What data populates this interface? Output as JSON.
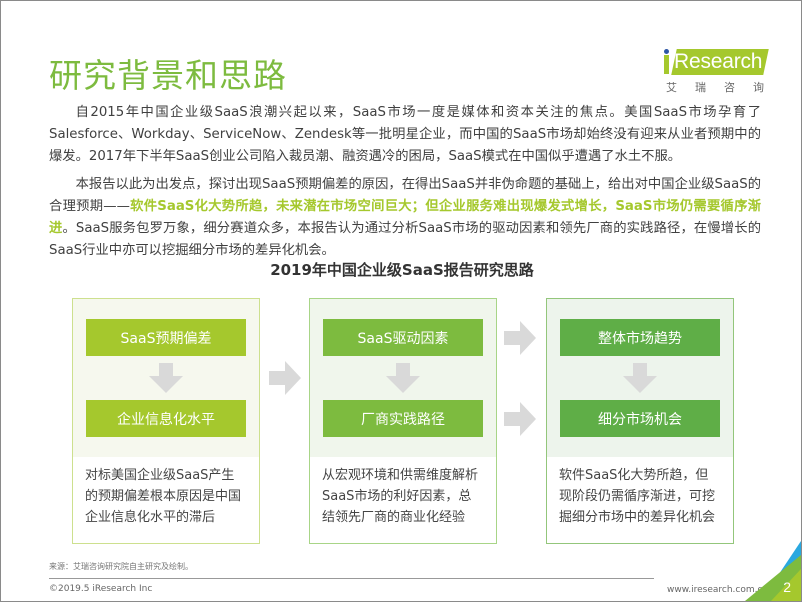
{
  "page": {
    "title": "研究背景和思路",
    "number": "2"
  },
  "logo": {
    "brand": "iResearch",
    "brand_rest": "Research",
    "subtitle": "艾瑞咨询"
  },
  "body": {
    "paragraph1": "自2015年中国企业级SaaS浪潮兴起以来，SaaS市场一度是媒体和资本关注的焦点。美国SaaS市场孕育了Salesforce、Workday、ServiceNow、Zendesk等一批明星企业，而中国的SaaS市场却始终没有迎来从业者预期中的爆发。2017年下半年SaaS创业公司陷入裁员潮、融资遇冷的困局，SaaS模式在中国似乎遭遇了水土不服。",
    "paragraph2_before": "本报告以此为出发点，探讨出现SaaS预期偏差的原因，在得出SaaS并非伪命题的基础上，给出对中国企业级SaaS的合理预期——",
    "paragraph2_highlight": "软件SaaS化大势所趋，未来潜在市场空间巨大；但企业服务难出现爆发式增长，SaaS市场仍需要循序渐进",
    "paragraph2_after": "。SaaS服务包罗万象，细分赛道众多，本报告认为通过分析SaaS市场的驱动因素和领先厂商的实践路径，在慢增长的SaaS行业中亦可以挖掘细分市场的差异化机会。"
  },
  "diagram": {
    "title": "2019年中国企业级SaaS报告研究思路",
    "panels": [
      {
        "top_box": "SaaS预期偏差",
        "bottom_box": "企业信息化水平",
        "description": "对标美国企业级SaaS产生的预期偏差根本原因是中国企业信息化水平的滞后",
        "color": "#a5c82d"
      },
      {
        "top_box": "SaaS驱动因素",
        "bottom_box": "厂商实践路径",
        "description": "从宏观环境和供需维度解析SaaS市场的利好因素，总结领先厂商的商业化经验",
        "color": "#7dbb3f"
      },
      {
        "top_box": "整体市场趋势",
        "bottom_box": "细分市场机会",
        "description": "软件SaaS化大势所趋，但现阶段仍需循序渐进，可挖掘细分市场中的差异化机会",
        "color": "#5fae47"
      }
    ]
  },
  "footer": {
    "source": "来源：艾瑞咨询研究院自主研究及绘制。",
    "copyright": "©2019.5 iResearch Inc",
    "website": "www.iresearch.com.cn"
  },
  "colors": {
    "accent_green": "#7dbb3f",
    "yellow_green": "#a5c82d",
    "deep_green": "#5fae47",
    "logo_blue": "#2d56a5",
    "arrow_gray": "#d9d9d9"
  }
}
